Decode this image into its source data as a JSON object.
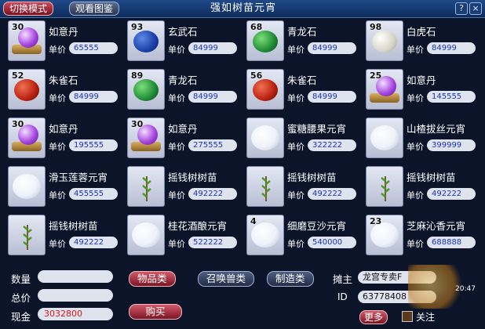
{
  "header": {
    "switch_mode": "切换模式",
    "view_catalog": "观看图鉴",
    "title": "强如树苗元宵"
  },
  "price_label": "单价",
  "items": [
    {
      "name": "如意丹",
      "qty": "30",
      "price": "65555",
      "icon": "pill-icon"
    },
    {
      "name": "玄武石",
      "qty": "93",
      "price": "84999",
      "icon": "blue-stone-icon"
    },
    {
      "name": "青龙石",
      "qty": "68",
      "price": "84999",
      "icon": "green-stone-icon"
    },
    {
      "name": "白虎石",
      "qty": "98",
      "price": "84999",
      "icon": "white-stone-icon"
    },
    {
      "name": "朱雀石",
      "qty": "52",
      "price": "84999",
      "icon": "red-stone-icon"
    },
    {
      "name": "青龙石",
      "qty": "89",
      "price": "84999",
      "icon": "green-stone-icon"
    },
    {
      "name": "朱雀石",
      "qty": "56",
      "price": "84999",
      "icon": "red-stone-icon"
    },
    {
      "name": "如意丹",
      "qty": "25",
      "price": "145555",
      "icon": "pill-icon"
    },
    {
      "name": "如意丹",
      "qty": "30",
      "price": "195555",
      "icon": "pill-icon"
    },
    {
      "name": "如意丹",
      "qty": "30",
      "price": "275555",
      "icon": "pill-icon"
    },
    {
      "name": "蜜糖腰果元宵",
      "qty": "",
      "price": "322222",
      "icon": "yuanxiao-icon"
    },
    {
      "name": "山楂拔丝元宵",
      "qty": "",
      "price": "399999",
      "icon": "yuanxiao-icon"
    },
    {
      "name": "滑玉莲蓉元宵",
      "qty": "",
      "price": "455555",
      "icon": "yuanxiao-icon"
    },
    {
      "name": "摇钱树树苗",
      "qty": "",
      "price": "492222",
      "icon": "sapling-icon"
    },
    {
      "name": "摇钱树树苗",
      "qty": "",
      "price": "492222",
      "icon": "sapling-icon"
    },
    {
      "name": "摇钱树树苗",
      "qty": "",
      "price": "492222",
      "icon": "sapling-icon"
    },
    {
      "name": "摇钱树树苗",
      "qty": "",
      "price": "492222",
      "icon": "sapling-icon"
    },
    {
      "name": "桂花酒酿元宵",
      "qty": "",
      "price": "522222",
      "icon": "yuanxiao-icon"
    },
    {
      "name": "细磨豆沙元宵",
      "qty": "4",
      "price": "540000",
      "icon": "yuanxiao-icon"
    },
    {
      "name": "芝麻沁香元宵",
      "qty": "23",
      "price": "688888",
      "icon": "yuanxiao-icon"
    }
  ],
  "footer": {
    "quantity_label": "数量",
    "total_label": "总价",
    "cash_label": "现金",
    "cash_value": "3032800",
    "cat_items": "物品类",
    "cat_pets": "召唤兽类",
    "cat_craft": "制造类",
    "buy": "购买",
    "seller_label": "摊主",
    "seller_value": "龙宫专卖F",
    "id_label": "ID",
    "id_value": "63778408",
    "more": "更多",
    "follow": "关注",
    "time": "20:47"
  }
}
